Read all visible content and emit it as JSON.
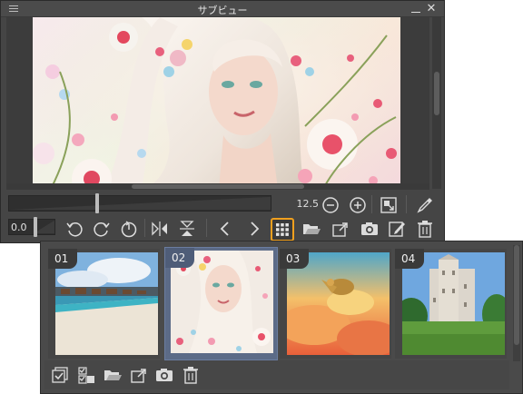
{
  "window": {
    "title": "サブビュー"
  },
  "toolbar": {
    "zoom_value": "12.5",
    "rotation_value": "0.0"
  },
  "browser": {
    "thumbnails": [
      {
        "number": "01",
        "selected": false
      },
      {
        "number": "02",
        "selected": true
      },
      {
        "number": "03",
        "selected": false
      },
      {
        "number": "04",
        "selected": false
      }
    ]
  },
  "colors": {
    "accent_highlight": "#f0a01e",
    "selection": "#5c6b87",
    "panel_bg": "#454545"
  },
  "icons": {
    "toolbar": [
      "zoom-out-icon",
      "zoom-in-icon",
      "fit-to-window-icon",
      "eyedropper-icon",
      "rotate-left-icon",
      "rotate-right-icon",
      "reset-rotation-icon",
      "flip-horizontal-icon",
      "flip-vertical-icon",
      "previous-image-icon",
      "next-image-icon",
      "image-list-icon",
      "open-file-icon",
      "import-image-icon",
      "camera-icon",
      "edit-icon",
      "delete-icon"
    ],
    "browser": [
      "select-all-icon",
      "checklist-icon",
      "open-folder-icon",
      "import-icon",
      "camera-icon",
      "trash-icon"
    ]
  }
}
